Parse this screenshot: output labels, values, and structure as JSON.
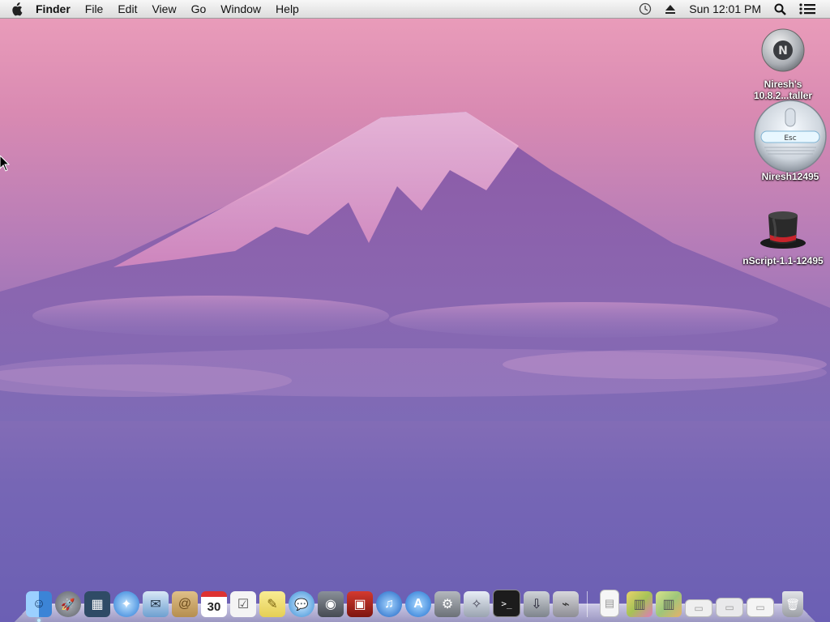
{
  "menubar": {
    "app_name": "Finder",
    "menus": [
      "File",
      "Edit",
      "View",
      "Go",
      "Window",
      "Help"
    ],
    "clock": "Sun 12:01 PM"
  },
  "desktop": {
    "icons": [
      {
        "label": "Niresh's 10.8.2...taller"
      },
      {
        "label": "Niresh12495"
      },
      {
        "label": "nScript-1.1-12495"
      }
    ]
  },
  "dock": {
    "apps": [
      {
        "name": "finder-icon",
        "color": "#4a8fdc",
        "glyph": "☺"
      },
      {
        "name": "launchpad-icon",
        "color": "#7b7f88",
        "glyph": "🚀"
      },
      {
        "name": "mission-control-icon",
        "color": "#3a5a7a",
        "glyph": "▦"
      },
      {
        "name": "safari-icon",
        "color": "#3b8fe0",
        "glyph": "✦"
      },
      {
        "name": "mail-icon",
        "color": "#6d9fd0",
        "glyph": "✉"
      },
      {
        "name": "contacts-icon",
        "color": "#c8a56a",
        "glyph": "@"
      },
      {
        "name": "calendar-icon",
        "color": "#ffffff",
        "glyph": "30"
      },
      {
        "name": "reminders-icon",
        "color": "#f2f2f2",
        "glyph": "☑"
      },
      {
        "name": "notes-icon",
        "color": "#f3e27a",
        "glyph": "✎"
      },
      {
        "name": "messages-icon",
        "color": "#5aa8e6",
        "glyph": "💬"
      },
      {
        "name": "facetime-icon",
        "color": "#5a5f66",
        "glyph": "◉"
      },
      {
        "name": "photo-booth-icon",
        "color": "#b3241d",
        "glyph": "▣"
      },
      {
        "name": "itunes-icon",
        "color": "#2d7de0",
        "glyph": "♫"
      },
      {
        "name": "app-store-icon",
        "color": "#2f8be6",
        "glyph": "A"
      },
      {
        "name": "system-preferences-icon",
        "color": "#8a8f96",
        "glyph": "⚙"
      },
      {
        "name": "wizard-icon",
        "color": "#c6ccd6",
        "glyph": "✧"
      },
      {
        "name": "terminal-icon",
        "color": "#222222",
        "glyph": ">_"
      },
      {
        "name": "installer-icon",
        "color": "#9aa0a8",
        "glyph": "⇩"
      },
      {
        "name": "network-utility-icon",
        "color": "#a8a8ae",
        "glyph": "⌁"
      }
    ],
    "stacks": [
      {
        "name": "document-icon",
        "color": "#f4f4f4",
        "glyph": "▤"
      },
      {
        "name": "applications-stack-icon",
        "color": "#d8c46a",
        "glyph": "▥"
      },
      {
        "name": "pictures-stack-icon",
        "color": "#b9d28a",
        "glyph": "▥"
      },
      {
        "name": "folder-stack-icon",
        "color": "#eeeeee",
        "glyph": "▭"
      },
      {
        "name": "downloads-stack-icon",
        "color": "#e8e8ea",
        "glyph": "▭"
      },
      {
        "name": "documents-stack-icon",
        "color": "#f2f2f2",
        "glyph": "▭"
      },
      {
        "name": "trash-icon",
        "color": "#b9bcc2",
        "glyph": "🗑"
      }
    ]
  }
}
